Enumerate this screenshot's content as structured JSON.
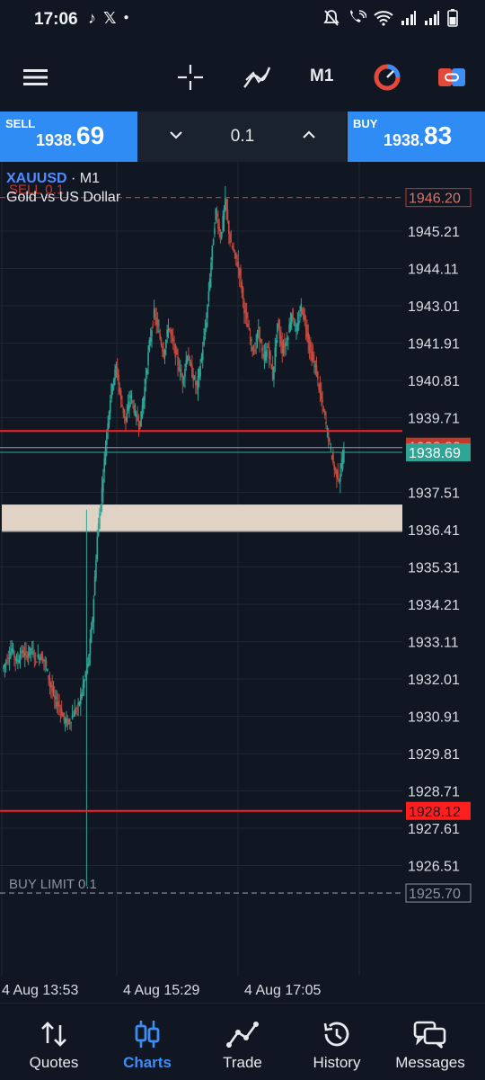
{
  "status_bar": {
    "time": "17:06"
  },
  "toolbar": {
    "timeframe": "M1"
  },
  "trade": {
    "sell_label": "SELL",
    "sell_price_small": "1938.",
    "sell_price_big": "69",
    "buy_label": "BUY",
    "buy_price_small": "1938.",
    "buy_price_big": "83",
    "volume": "0.1"
  },
  "chart": {
    "symbol": "XAUUSD",
    "timeframe_label": "· M1",
    "description": "Gold vs US Dollar",
    "sell_order_label": "SELL 0.1",
    "buy_limit_label": "BUY LIMIT 0.1"
  },
  "chart_data": {
    "type": "candlestick",
    "y_ticks": [
      "1945.21",
      "1944.11",
      "1943.01",
      "1941.91",
      "1940.81",
      "1939.71",
      "1937.51",
      "1936.41",
      "1935.31",
      "1934.21",
      "1933.11",
      "1932.01",
      "1930.91",
      "1929.81",
      "1928.71",
      "1927.61",
      "1926.51"
    ],
    "ylim": [
      1925.6,
      1946.6
    ],
    "x_ticks": [
      "4 Aug 13:53",
      "4 Aug 15:29",
      "4 Aug 17:05"
    ],
    "price_tags": {
      "sell_order": "1946.20",
      "current_bid": "1938.69",
      "hidden_line": "1938.83",
      "stop_line": "1928.12",
      "buy_limit": "1925.70"
    },
    "horizontal_lines": [
      1946.2,
      1939.2,
      1928.12,
      1925.7
    ],
    "zone": [
      1936.35,
      1937.15
    ],
    "line_colors": {
      "sell_order": "#c0392b",
      "red_line": "#ff1f1f",
      "bid": "#2fa596",
      "buy_limit": "#8a93a3",
      "zone": "#e0d3c6"
    },
    "path_points": [
      [
        0,
        1932.3
      ],
      [
        4,
        1932.6
      ],
      [
        8,
        1932.9
      ],
      [
        12,
        1932.5
      ],
      [
        16,
        1932.8
      ],
      [
        20,
        1932.7
      ],
      [
        24,
        1932.9
      ],
      [
        28,
        1932.6
      ],
      [
        32,
        1932.7
      ],
      [
        36,
        1932.5
      ],
      [
        40,
        1931.9
      ],
      [
        44,
        1931.4
      ],
      [
        48,
        1931.2
      ],
      [
        52,
        1930.8
      ],
      [
        56,
        1930.7
      ],
      [
        60,
        1931.0
      ],
      [
        64,
        1931.2
      ],
      [
        68,
        1931.8
      ],
      [
        72,
        1932.4
      ],
      [
        76,
        1933.8
      ],
      [
        80,
        1936.2
      ],
      [
        84,
        1937.6
      ],
      [
        88,
        1939.3
      ],
      [
        92,
        1940.6
      ],
      [
        96,
        1941.2
      ],
      [
        100,
        1940.2
      ],
      [
        104,
        1939.6
      ],
      [
        108,
        1940.4
      ],
      [
        112,
        1939.8
      ],
      [
        116,
        1939.5
      ],
      [
        120,
        1940.6
      ],
      [
        124,
        1941.9
      ],
      [
        128,
        1942.8
      ],
      [
        132,
        1942.2
      ],
      [
        136,
        1941.6
      ],
      [
        140,
        1942.4
      ],
      [
        144,
        1941.9
      ],
      [
        148,
        1941.3
      ],
      [
        152,
        1940.8
      ],
      [
        156,
        1941.6
      ],
      [
        160,
        1941.0
      ],
      [
        164,
        1940.6
      ],
      [
        168,
        1941.5
      ],
      [
        172,
        1942.6
      ],
      [
        176,
        1944.3
      ],
      [
        180,
        1945.8
      ],
      [
        184,
        1945.0
      ],
      [
        188,
        1946.1
      ],
      [
        192,
        1944.9
      ],
      [
        196,
        1944.5
      ],
      [
        200,
        1944.0
      ],
      [
        204,
        1942.9
      ],
      [
        208,
        1942.2
      ],
      [
        212,
        1941.6
      ],
      [
        216,
        1942.3
      ],
      [
        220,
        1941.4
      ],
      [
        224,
        1941.8
      ],
      [
        228,
        1940.9
      ],
      [
        232,
        1942.5
      ],
      [
        236,
        1941.7
      ],
      [
        240,
        1942.0
      ],
      [
        244,
        1942.8
      ],
      [
        248,
        1942.2
      ],
      [
        252,
        1943.0
      ],
      [
        256,
        1942.4
      ],
      [
        260,
        1941.6
      ],
      [
        264,
        1941.2
      ],
      [
        268,
        1940.4
      ],
      [
        272,
        1939.7
      ],
      [
        276,
        1938.9
      ],
      [
        280,
        1938.2
      ],
      [
        284,
        1937.9
      ],
      [
        288,
        1938.7
      ]
    ]
  },
  "bottom_nav": {
    "items": [
      {
        "label": "Quotes",
        "icon": "quotes-arrows-icon"
      },
      {
        "label": "Charts",
        "icon": "charts-candles-icon"
      },
      {
        "label": "Trade",
        "icon": "trade-line-icon"
      },
      {
        "label": "History",
        "icon": "history-clock-icon"
      },
      {
        "label": "Messages",
        "icon": "messages-bubbles-icon"
      }
    ],
    "active": "Charts"
  }
}
